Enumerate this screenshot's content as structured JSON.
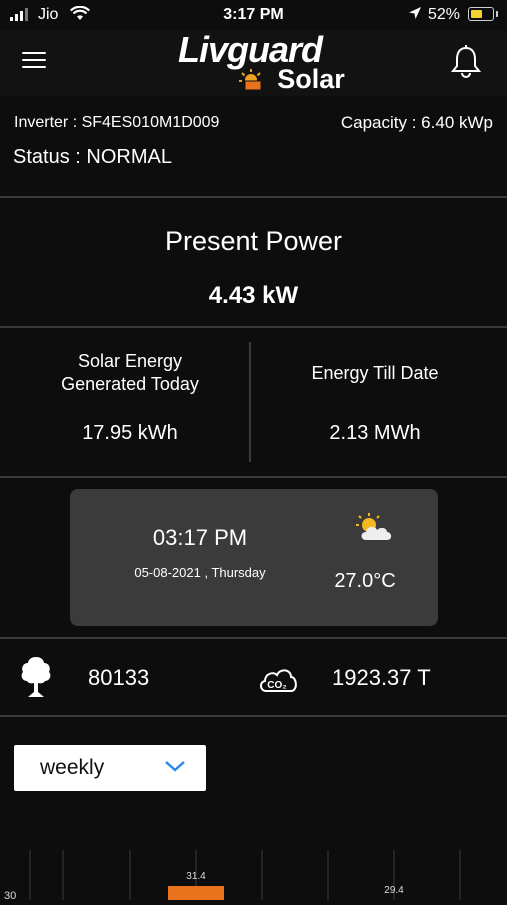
{
  "status_bar": {
    "carrier": "Jio",
    "time": "3:17 PM",
    "battery": "52%"
  },
  "header": {
    "brand": "Livguard",
    "brand_sub": "Solar"
  },
  "info": {
    "inverter": "Inverter : SF4ES010M1D009",
    "capacity": "Capacity : 6.40 kWp",
    "status": "Status : NORMAL"
  },
  "present_power": {
    "title": "Present Power",
    "value": "4.43 kW"
  },
  "energy": {
    "today_title_1": "Solar Energy",
    "today_title_2": "Generated Today",
    "today_value": "17.95 kWh",
    "total_title": "Energy Till Date",
    "total_value": "2.13 MWh"
  },
  "weather": {
    "time": "03:17 PM",
    "date": "05-08-2021 , Thursday",
    "temperature": "27.0°C",
    "icon": "partly-cloudy-icon"
  },
  "environment": {
    "trees_value": "80133",
    "trees_icon": "tree-icon",
    "co2_value": "1923.37 T",
    "co2_icon": "co2-cloud-icon"
  },
  "period_select": {
    "selected": "weekly"
  },
  "chart_data": {
    "type": "bar",
    "y_tick_visible": [
      "30"
    ],
    "data_labels": [
      "31.4",
      "29.4"
    ],
    "bar_color": "#e8731c"
  },
  "colors": {
    "background": "#0d0d0d",
    "card": "#3b3b3b",
    "accent": "#e8731c",
    "chevron": "#2a8ae6"
  }
}
